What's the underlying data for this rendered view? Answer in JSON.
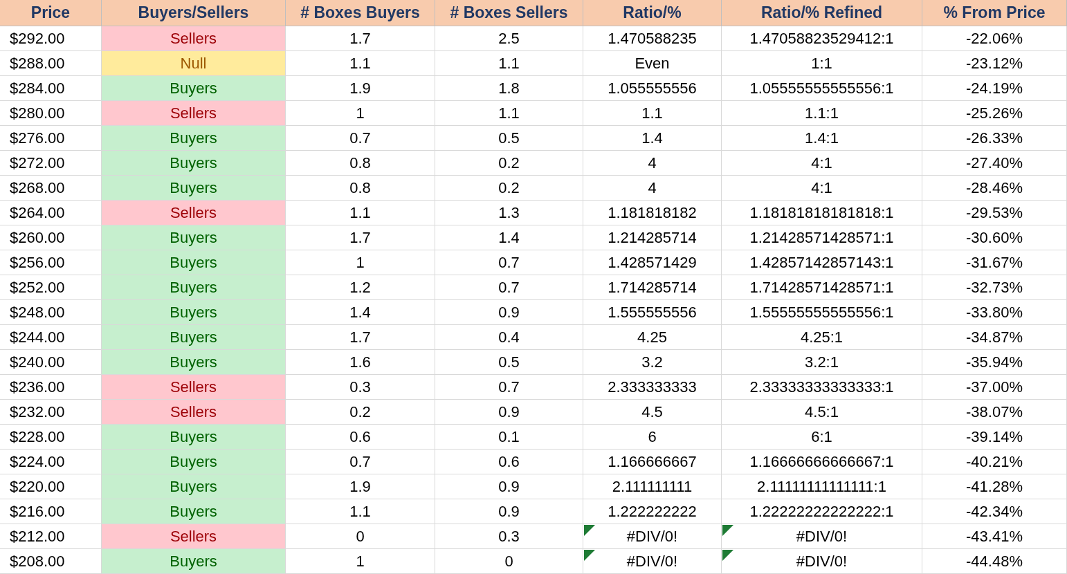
{
  "table": {
    "columns": [
      "Price",
      "Buyers/Sellers",
      "# Boxes Buyers",
      "# Boxes Sellers",
      "Ratio/%",
      "Ratio/% Refined",
      "% From Price"
    ],
    "rows": [
      {
        "price": "$292.00",
        "signal": "Sellers",
        "kind": "sellers",
        "boxes_buyers": "1.7",
        "boxes_sellers": "2.5",
        "ratio": "1.470588235",
        "ratio_refined": "1.47058823529412:1",
        "from_price": "-22.06%",
        "flagged": false
      },
      {
        "price": "$288.00",
        "signal": "Null",
        "kind": "neutral",
        "boxes_buyers": "1.1",
        "boxes_sellers": "1.1",
        "ratio": "Even",
        "ratio_refined": "1:1",
        "from_price": "-23.12%",
        "flagged": false
      },
      {
        "price": "$284.00",
        "signal": "Buyers",
        "kind": "buyers",
        "boxes_buyers": "1.9",
        "boxes_sellers": "1.8",
        "ratio": "1.055555556",
        "ratio_refined": "1.05555555555556:1",
        "from_price": "-24.19%",
        "flagged": false
      },
      {
        "price": "$280.00",
        "signal": "Sellers",
        "kind": "sellers",
        "boxes_buyers": "1",
        "boxes_sellers": "1.1",
        "ratio": "1.1",
        "ratio_refined": "1.1:1",
        "from_price": "-25.26%",
        "flagged": false
      },
      {
        "price": "$276.00",
        "signal": "Buyers",
        "kind": "buyers",
        "boxes_buyers": "0.7",
        "boxes_sellers": "0.5",
        "ratio": "1.4",
        "ratio_refined": "1.4:1",
        "from_price": "-26.33%",
        "flagged": false
      },
      {
        "price": "$272.00",
        "signal": "Buyers",
        "kind": "buyers",
        "boxes_buyers": "0.8",
        "boxes_sellers": "0.2",
        "ratio": "4",
        "ratio_refined": "4:1",
        "from_price": "-27.40%",
        "flagged": false
      },
      {
        "price": "$268.00",
        "signal": "Buyers",
        "kind": "buyers",
        "boxes_buyers": "0.8",
        "boxes_sellers": "0.2",
        "ratio": "4",
        "ratio_refined": "4:1",
        "from_price": "-28.46%",
        "flagged": false
      },
      {
        "price": "$264.00",
        "signal": "Sellers",
        "kind": "sellers",
        "boxes_buyers": "1.1",
        "boxes_sellers": "1.3",
        "ratio": "1.181818182",
        "ratio_refined": "1.18181818181818:1",
        "from_price": "-29.53%",
        "flagged": false
      },
      {
        "price": "$260.00",
        "signal": "Buyers",
        "kind": "buyers",
        "boxes_buyers": "1.7",
        "boxes_sellers": "1.4",
        "ratio": "1.214285714",
        "ratio_refined": "1.21428571428571:1",
        "from_price": "-30.60%",
        "flagged": false
      },
      {
        "price": "$256.00",
        "signal": "Buyers",
        "kind": "buyers",
        "boxes_buyers": "1",
        "boxes_sellers": "0.7",
        "ratio": "1.428571429",
        "ratio_refined": "1.42857142857143:1",
        "from_price": "-31.67%",
        "flagged": false
      },
      {
        "price": "$252.00",
        "signal": "Buyers",
        "kind": "buyers",
        "boxes_buyers": "1.2",
        "boxes_sellers": "0.7",
        "ratio": "1.714285714",
        "ratio_refined": "1.71428571428571:1",
        "from_price": "-32.73%",
        "flagged": false
      },
      {
        "price": "$248.00",
        "signal": "Buyers",
        "kind": "buyers",
        "boxes_buyers": "1.4",
        "boxes_sellers": "0.9",
        "ratio": "1.555555556",
        "ratio_refined": "1.55555555555556:1",
        "from_price": "-33.80%",
        "flagged": false
      },
      {
        "price": "$244.00",
        "signal": "Buyers",
        "kind": "buyers",
        "boxes_buyers": "1.7",
        "boxes_sellers": "0.4",
        "ratio": "4.25",
        "ratio_refined": "4.25:1",
        "from_price": "-34.87%",
        "flagged": false
      },
      {
        "price": "$240.00",
        "signal": "Buyers",
        "kind": "buyers",
        "boxes_buyers": "1.6",
        "boxes_sellers": "0.5",
        "ratio": "3.2",
        "ratio_refined": "3.2:1",
        "from_price": "-35.94%",
        "flagged": false
      },
      {
        "price": "$236.00",
        "signal": "Sellers",
        "kind": "sellers",
        "boxes_buyers": "0.3",
        "boxes_sellers": "0.7",
        "ratio": "2.333333333",
        "ratio_refined": "2.33333333333333:1",
        "from_price": "-37.00%",
        "flagged": false
      },
      {
        "price": "$232.00",
        "signal": "Sellers",
        "kind": "sellers",
        "boxes_buyers": "0.2",
        "boxes_sellers": "0.9",
        "ratio": "4.5",
        "ratio_refined": "4.5:1",
        "from_price": "-38.07%",
        "flagged": false
      },
      {
        "price": "$228.00",
        "signal": "Buyers",
        "kind": "buyers",
        "boxes_buyers": "0.6",
        "boxes_sellers": "0.1",
        "ratio": "6",
        "ratio_refined": "6:1",
        "from_price": "-39.14%",
        "flagged": false
      },
      {
        "price": "$224.00",
        "signal": "Buyers",
        "kind": "buyers",
        "boxes_buyers": "0.7",
        "boxes_sellers": "0.6",
        "ratio": "1.166666667",
        "ratio_refined": "1.16666666666667:1",
        "from_price": "-40.21%",
        "flagged": false
      },
      {
        "price": "$220.00",
        "signal": "Buyers",
        "kind": "buyers",
        "boxes_buyers": "1.9",
        "boxes_sellers": "0.9",
        "ratio": "2.111111111",
        "ratio_refined": "2.11111111111111:1",
        "from_price": "-41.28%",
        "flagged": false
      },
      {
        "price": "$216.00",
        "signal": "Buyers",
        "kind": "buyers",
        "boxes_buyers": "1.1",
        "boxes_sellers": "0.9",
        "ratio": "1.222222222",
        "ratio_refined": "1.22222222222222:1",
        "from_price": "-42.34%",
        "flagged": false
      },
      {
        "price": "$212.00",
        "signal": "Sellers",
        "kind": "sellers",
        "boxes_buyers": "0",
        "boxes_sellers": "0.3",
        "ratio": "#DIV/0!",
        "ratio_refined": "#DIV/0!",
        "from_price": "-43.41%",
        "flagged": true
      },
      {
        "price": "$208.00",
        "signal": "Buyers",
        "kind": "buyers",
        "boxes_buyers": "1",
        "boxes_sellers": "0",
        "ratio": "#DIV/0!",
        "ratio_refined": "#DIV/0!",
        "from_price": "-44.48%",
        "flagged": true
      }
    ]
  }
}
